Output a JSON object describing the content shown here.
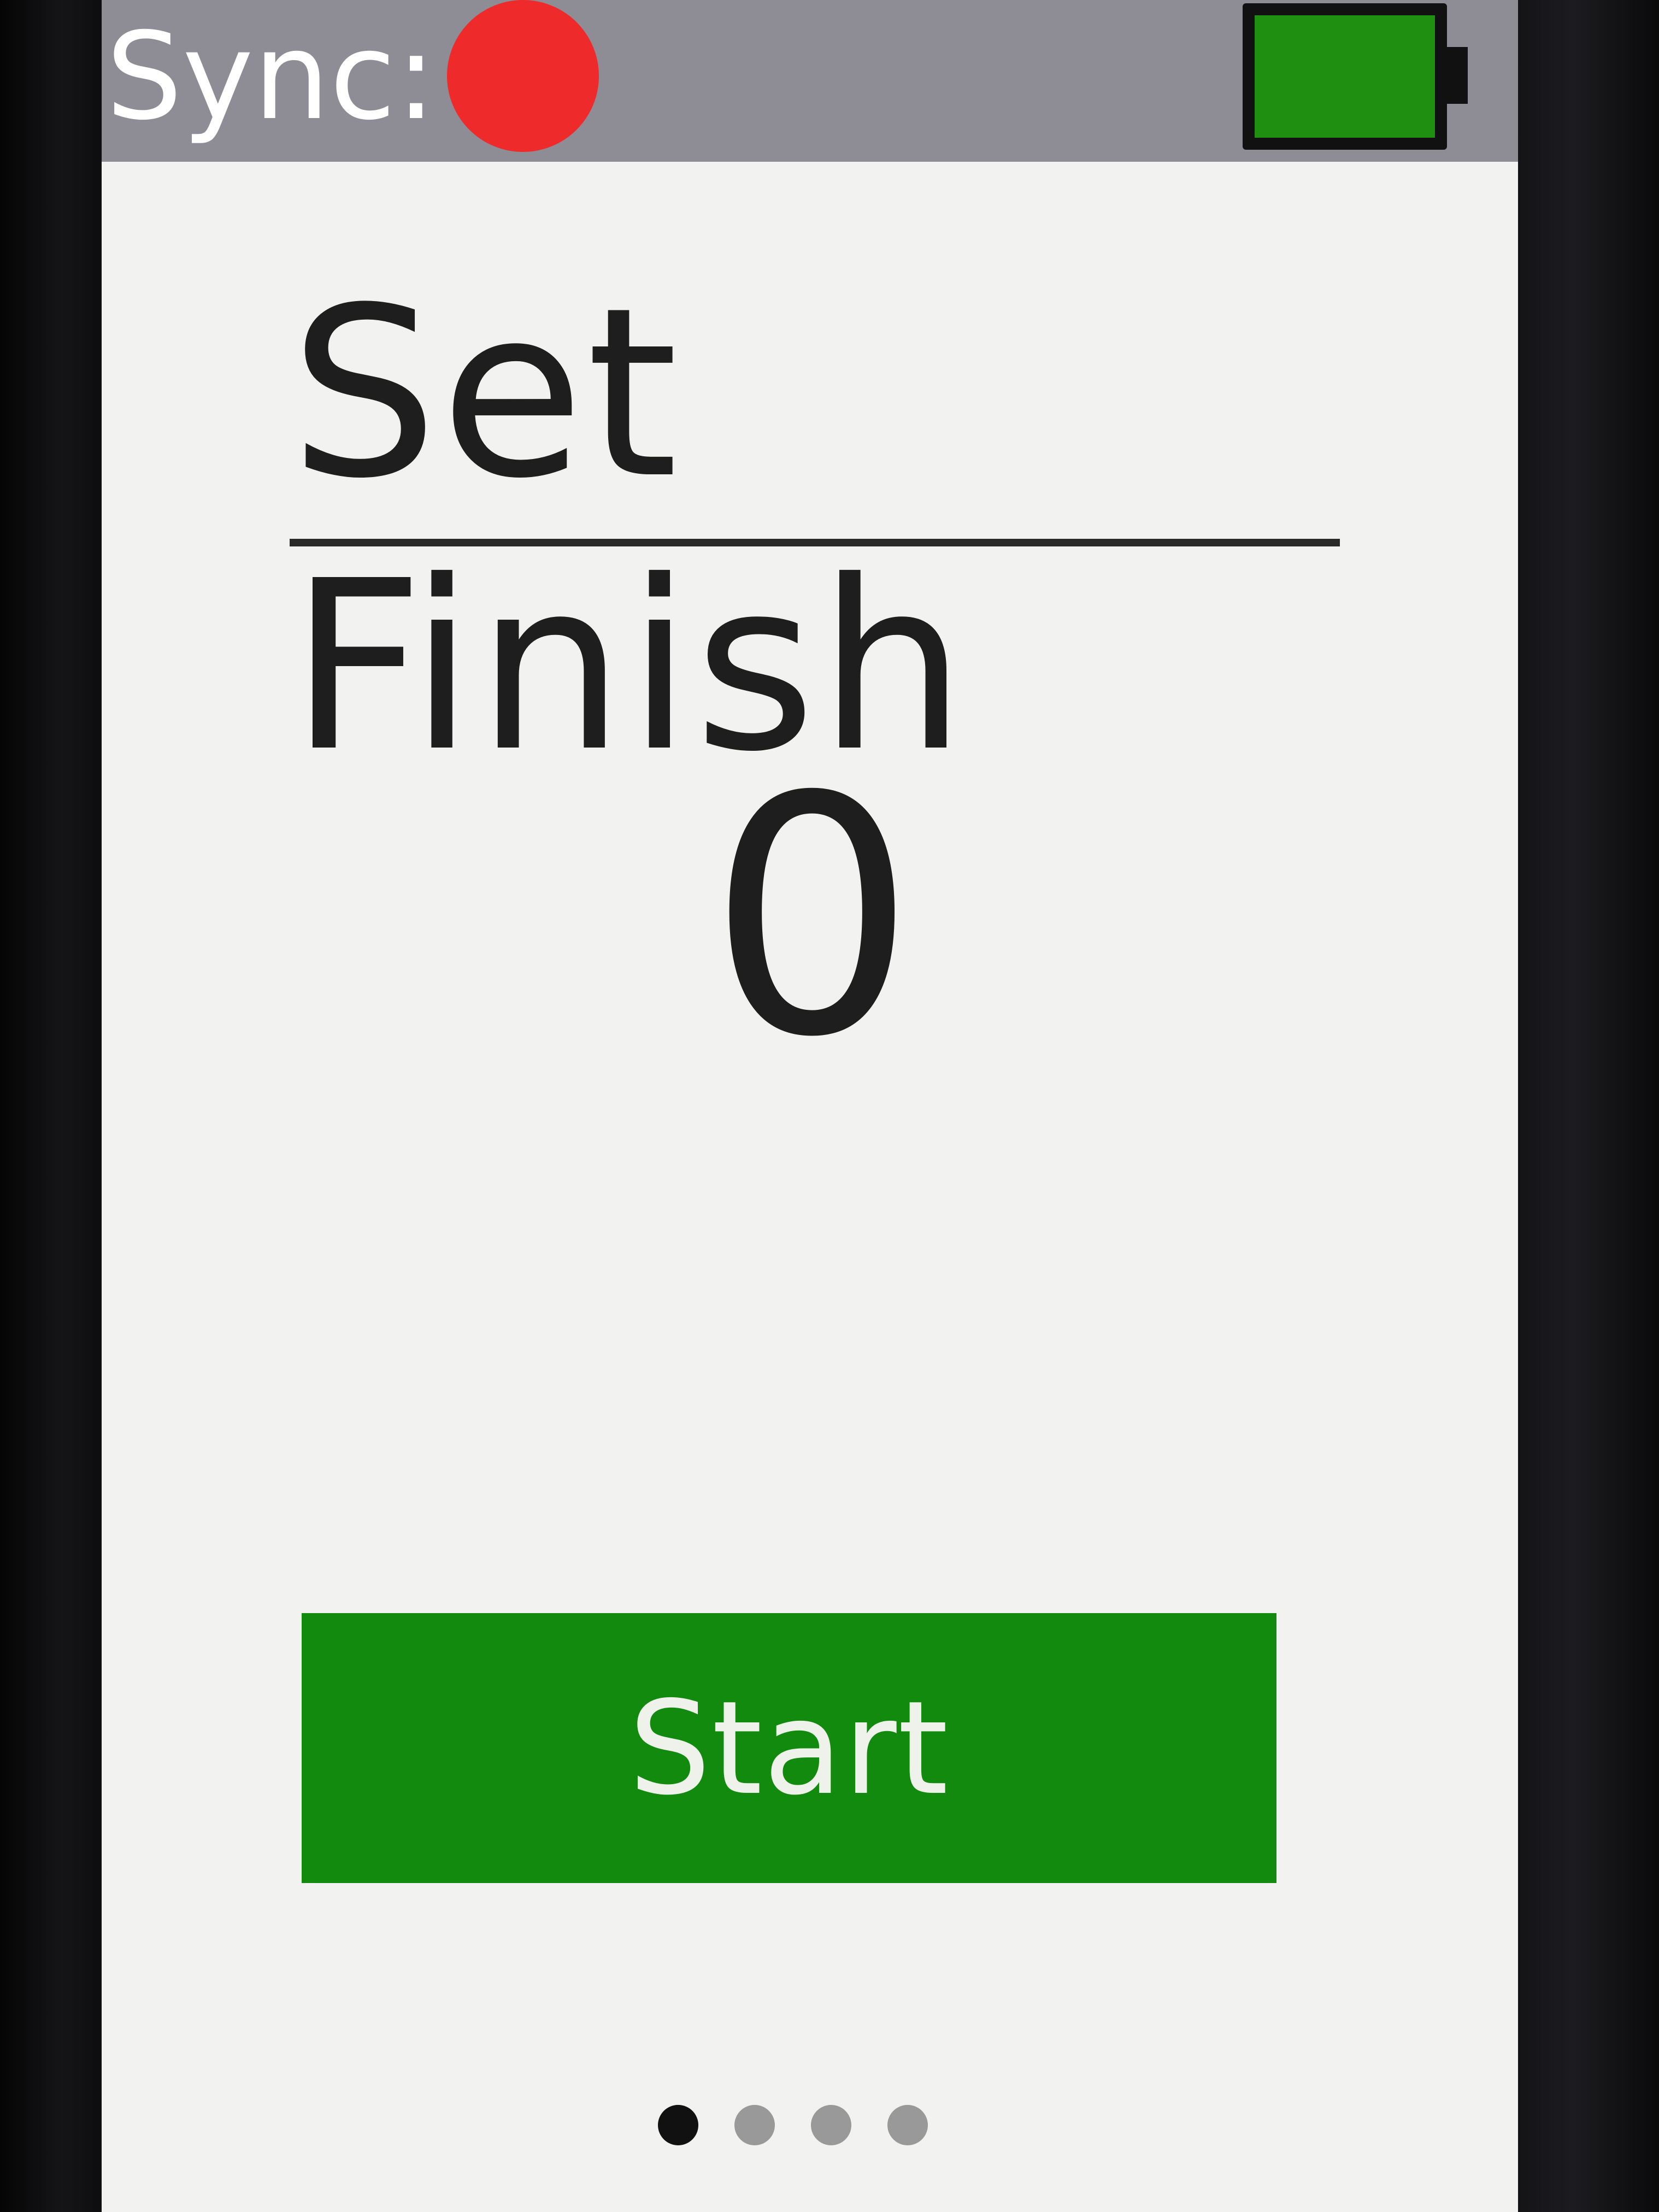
{
  "status_bar": {
    "sync_label": "Sync:",
    "sync_status_color": "#ee2a2a",
    "sync_icon": "record-dot-icon",
    "battery_icon": "battery-icon",
    "battery_level": 1.0,
    "battery_color": "#1f8f12"
  },
  "main": {
    "title": "Set Finish",
    "counter_value": "0",
    "start_button_label": "Start",
    "start_button_color": "#118a0e"
  },
  "pager": {
    "total_pages": 4,
    "current_page": 1,
    "active_color": "#111111",
    "inactive_color": "#999999"
  }
}
